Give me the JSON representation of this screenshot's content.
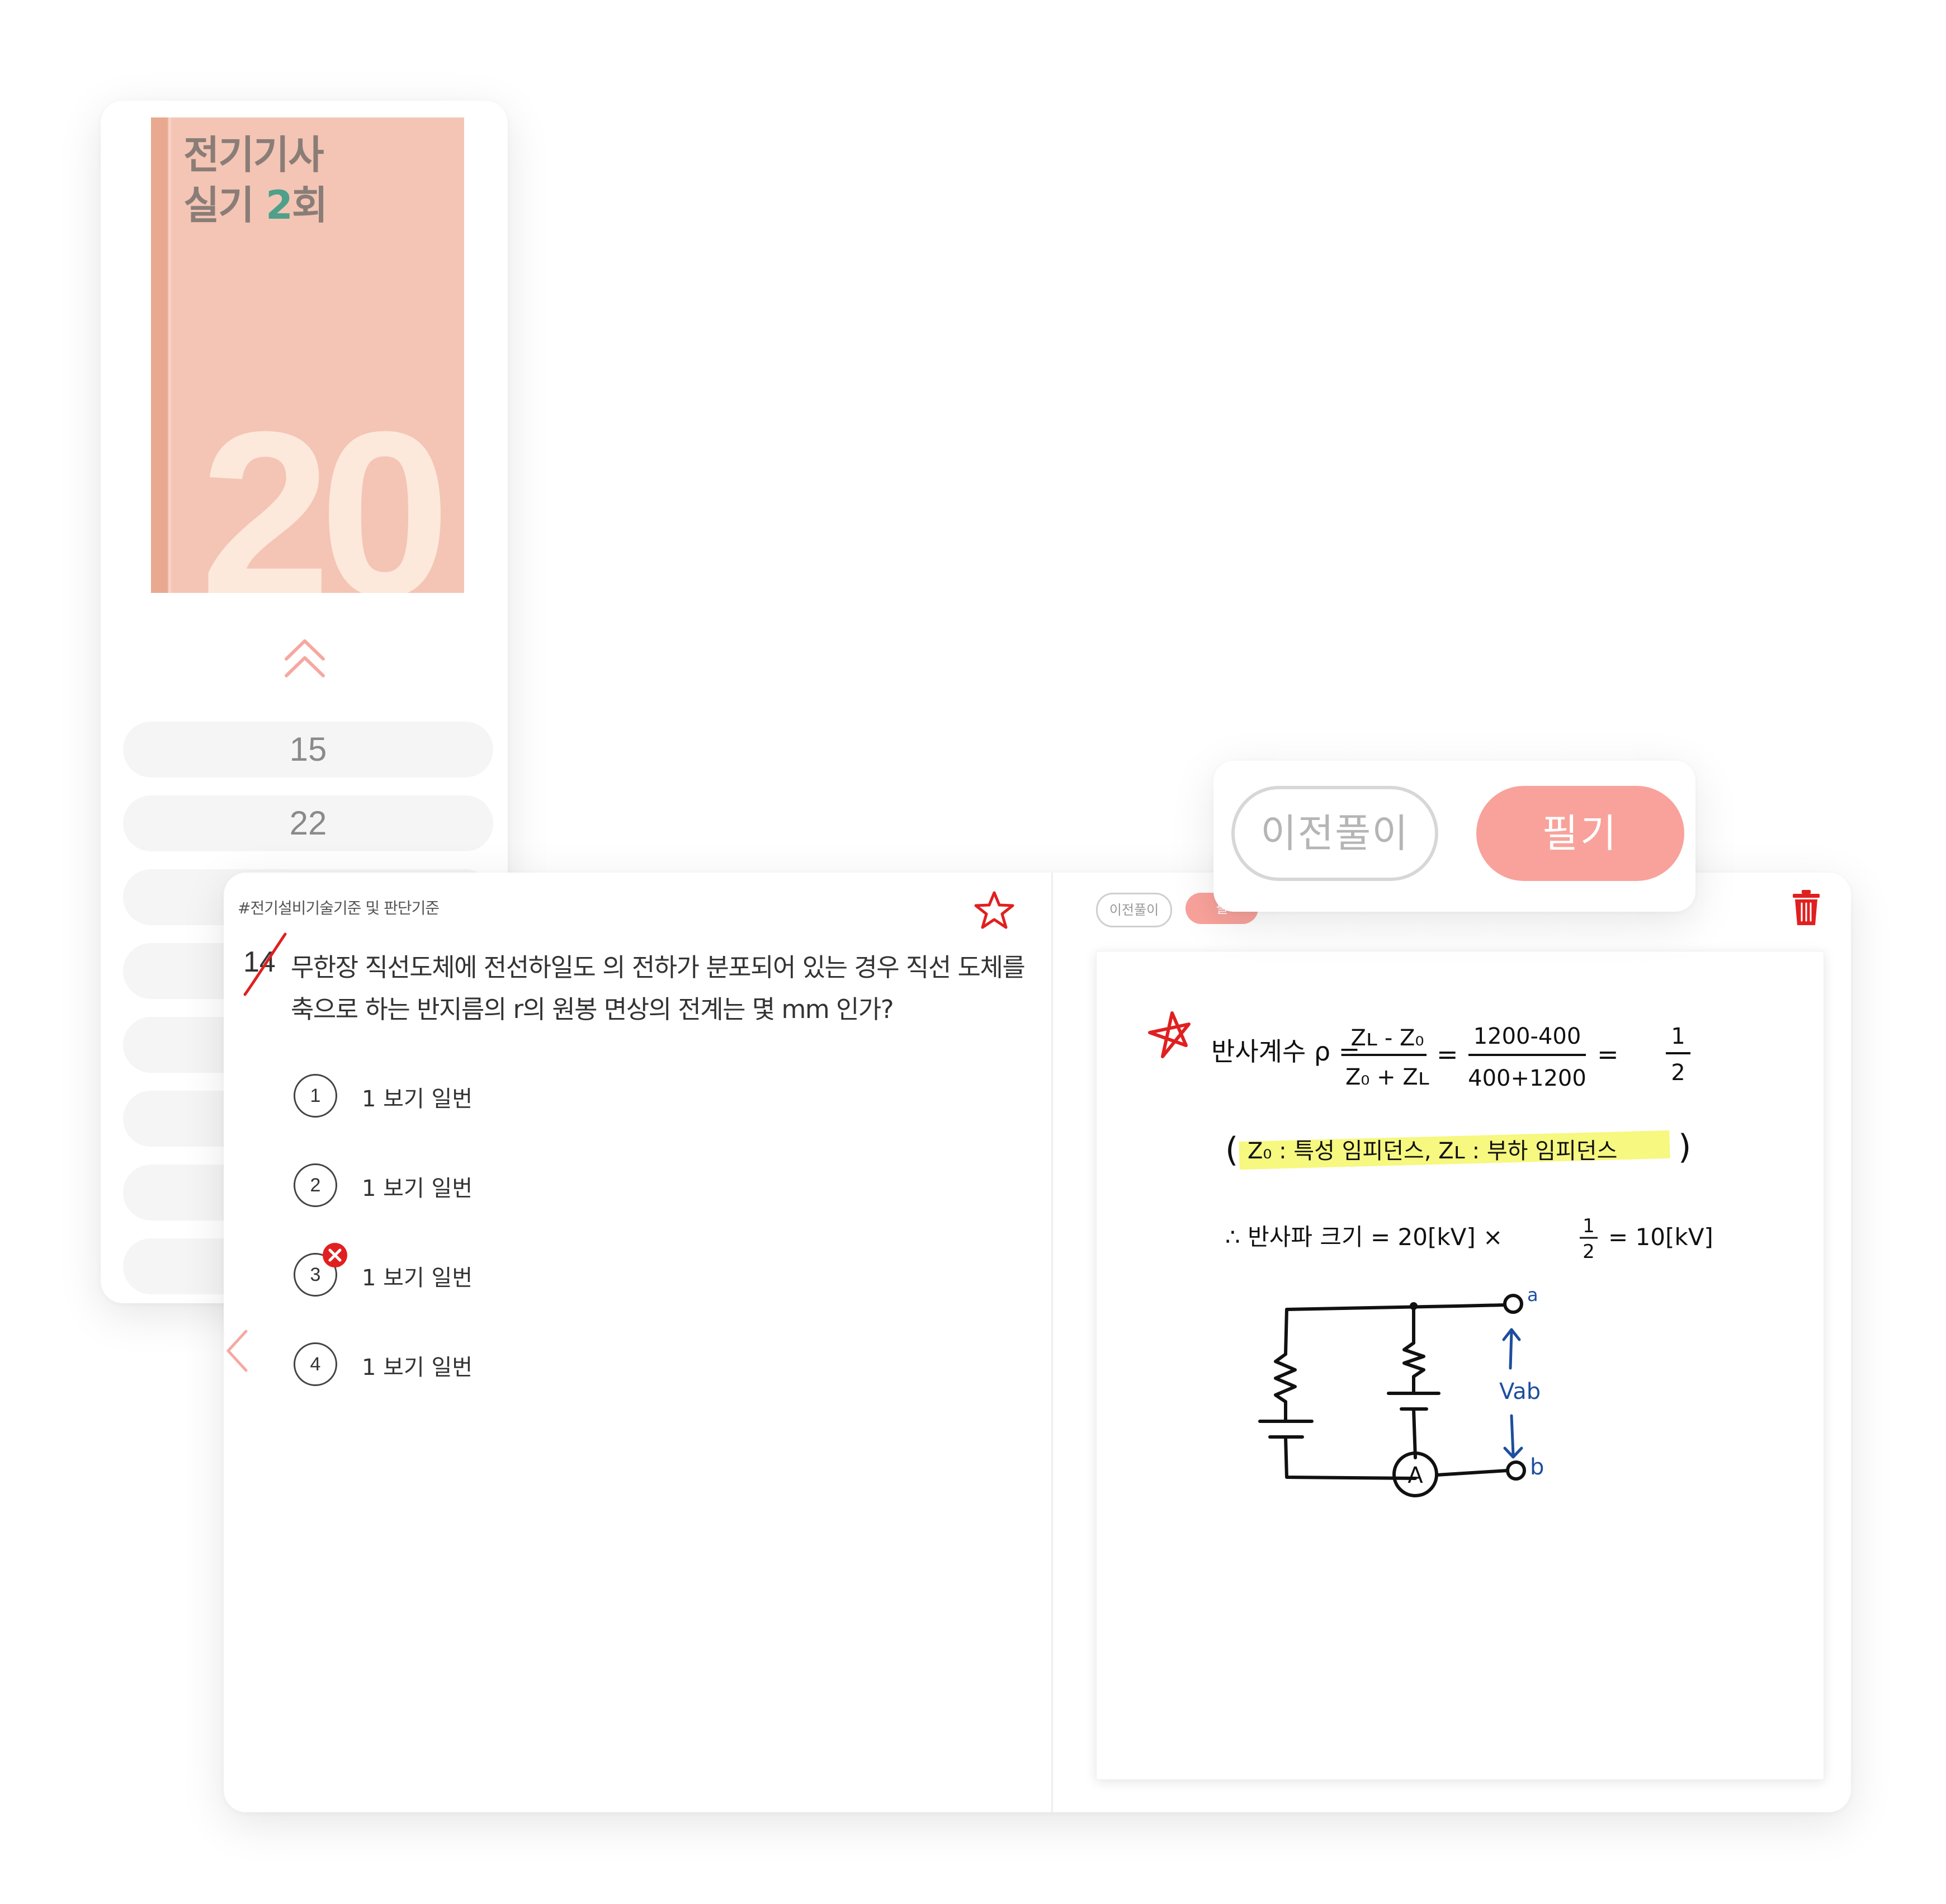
{
  "book": {
    "title_line1": "전기기사",
    "title_line2_prefix": "실기 ",
    "title_line2_accent": "2",
    "title_line2_suffix": "회",
    "year": "20"
  },
  "sidebar": {
    "items": [
      {
        "label": "15"
      },
      {
        "label": "22"
      },
      {
        "label": ""
      },
      {
        "label": ""
      },
      {
        "label": ""
      },
      {
        "label": ""
      },
      {
        "label": ""
      },
      {
        "label": ""
      }
    ]
  },
  "question": {
    "category": "#전기설비기술기준 및 판단기준",
    "number": "14",
    "text": "무한장 직선도체에 전선하일도 의 전하가 분포되어 있는 경우 직선 도체를 축으로 하는 반지름의 r의 원봉 면상의 전계는 몇 mm 인가?",
    "choices": [
      {
        "num": "1",
        "label": "1 보기 일번"
      },
      {
        "num": "2",
        "label": "1 보기 일번"
      },
      {
        "num": "3",
        "label": "1 보기 일번"
      },
      {
        "num": "4",
        "label": "1 보기 일번"
      }
    ]
  },
  "note_tabs": {
    "prev_solution": "이전풀이",
    "note": "필"
  },
  "popup": {
    "prev_solution": "이전풀이",
    "note": "필기"
  },
  "handwriting": {
    "line1": "반사계수 ρ = (Zʟ - Z₀)/(Z₀ + Zʟ) = (1200-400)/(400+1200) = 1/2",
    "line2": "( Z₀ : 특성 임피던스, Zʟ : 부하 임피던스 )",
    "line3": "∴ 반사파 크기 = 20[kV] × 1/2 = 10[kV]",
    "frac1_num": "Zʟ - Z₀",
    "frac1_den": "Z₀ + Zʟ",
    "frac2_num": "1200-400",
    "frac2_den": "400+1200",
    "half_num": "1",
    "half_den": "2",
    "label_lhs": "반사계수 ρ =",
    "legend_text": "Z₀ : 특성 임피던스, Zʟ : 부하 임피던스",
    "result_prefix": "∴ 반사파 크기 = 20[kV] ×",
    "result_suffix": "= 10[kV]",
    "node_a": "a",
    "node_b": "b",
    "vab": "Vab",
    "ammeter": "A"
  },
  "colors": {
    "accent": "#f8a29b",
    "book_cover": "#f4c5b4",
    "red": "#e02020",
    "highlight": "#f5f76a",
    "ink_blue": "#1d4e9e"
  }
}
